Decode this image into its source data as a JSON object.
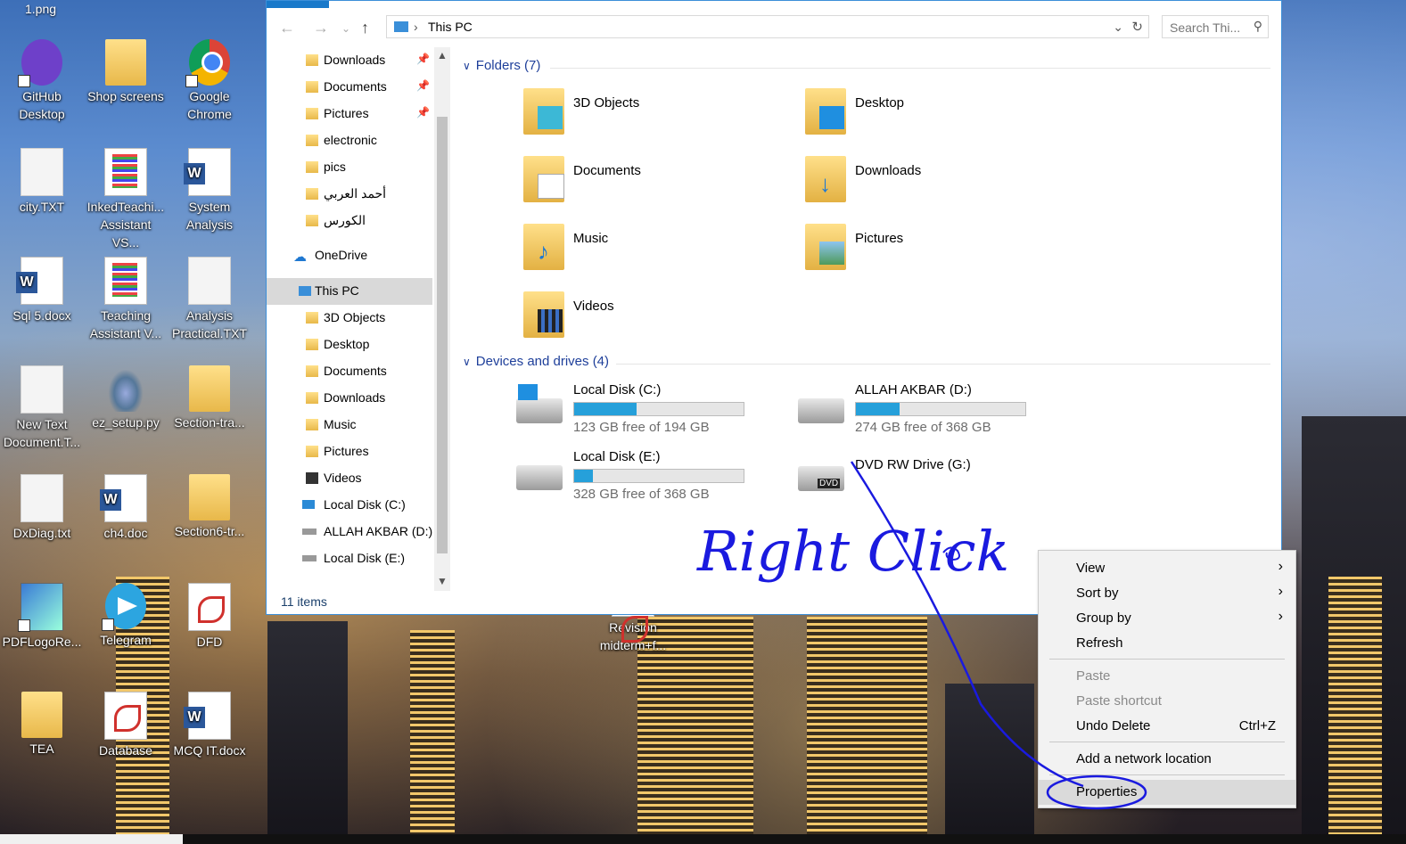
{
  "desktop": {
    "top_label": "1.png",
    "icons": [
      {
        "label": "GitHub Desktop",
        "icon": "github-icon"
      },
      {
        "label": "Shop screens",
        "icon": "folder-icon"
      },
      {
        "label": "Google Chrome",
        "icon": "chrome-icon"
      },
      {
        "label": "city.TXT",
        "icon": "text-file-icon"
      },
      {
        "label": "InkedTeachi... Assistant VS...",
        "icon": "image-file-icon"
      },
      {
        "label": "System Analysis",
        "icon": "word-doc-icon"
      },
      {
        "label": "Sql 5.docx",
        "icon": "word-doc-icon"
      },
      {
        "label": "Teaching Assistant V...",
        "icon": "image-file-icon"
      },
      {
        "label": "Analysis Practical.TXT",
        "icon": "text-file-icon"
      },
      {
        "label": "New Text Document.T...",
        "icon": "text-file-icon"
      },
      {
        "label": "ez_setup.py",
        "icon": "python-file-icon"
      },
      {
        "label": "Section-tra...",
        "icon": "folder-icon"
      },
      {
        "label": "DxDiag.txt",
        "icon": "text-file-icon"
      },
      {
        "label": "ch4.doc",
        "icon": "word-doc-icon"
      },
      {
        "label": "Section6-tr...",
        "icon": "folder-icon"
      },
      {
        "label": "PDFLogoRe...",
        "icon": "app-icon"
      },
      {
        "label": "Telegram",
        "icon": "telegram-icon"
      },
      {
        "label": "DFD",
        "icon": "pdf-icon"
      },
      {
        "label": "TEA",
        "icon": "folder-icon"
      },
      {
        "label": "Database",
        "icon": "pdf-icon"
      },
      {
        "label": "MCQ IT.docx",
        "icon": "word-doc-icon"
      },
      {
        "label": "Revision midterm+f...",
        "icon": "pdf-icon"
      }
    ]
  },
  "explorer": {
    "address": "This PC",
    "search_placeholder": "Search Thi...",
    "nav_items": [
      {
        "label": "Downloads",
        "pinned": true
      },
      {
        "label": "Documents",
        "pinned": true
      },
      {
        "label": "Pictures",
        "pinned": true
      },
      {
        "label": "electronic"
      },
      {
        "label": "pics"
      },
      {
        "label": "أحمد العربي"
      },
      {
        "label": "الكورس"
      },
      {
        "label": "OneDrive"
      },
      {
        "label": "This PC",
        "selected": true
      },
      {
        "label": "3D Objects"
      },
      {
        "label": "Desktop"
      },
      {
        "label": "Documents"
      },
      {
        "label": "Downloads"
      },
      {
        "label": "Music"
      },
      {
        "label": "Pictures"
      },
      {
        "label": "Videos"
      },
      {
        "label": "Local Disk (C:)"
      },
      {
        "label": "ALLAH AKBAR (D:)"
      },
      {
        "label": "Local Disk (E:)"
      }
    ],
    "folders_header": "Folders (7)",
    "folders": [
      "3D Objects",
      "Desktop",
      "Documents",
      "Downloads",
      "Music",
      "Pictures",
      "Videos"
    ],
    "devices_header": "Devices and drives (4)",
    "drives": [
      {
        "name": "Local Disk (C:)",
        "free": "123 GB free of 194 GB",
        "used_fraction": 0.37
      },
      {
        "name": "ALLAH AKBAR (D:)",
        "free": "274 GB free of 368 GB",
        "used_fraction": 0.26
      },
      {
        "name": "Local Disk (E:)",
        "free": "328 GB free of 368 GB",
        "used_fraction": 0.11
      },
      {
        "name": "DVD RW Drive (G:)",
        "free": "",
        "dvd_label": "DVD"
      }
    ],
    "status": "11 items",
    "accent_color": "#26a0da"
  },
  "context_menu": {
    "items": [
      {
        "label": "View",
        "submenu": true
      },
      {
        "label": "Sort by",
        "submenu": true
      },
      {
        "label": "Group by",
        "submenu": true
      },
      {
        "label": "Refresh"
      },
      {
        "label": "Paste",
        "disabled": true
      },
      {
        "label": "Paste shortcut",
        "disabled": true
      },
      {
        "label": "Undo Delete",
        "shortcut": "Ctrl+Z"
      },
      {
        "label": "Add a network location"
      },
      {
        "label": "Properties",
        "highlighted": true
      }
    ]
  },
  "annotation": {
    "text": "Right Click",
    "color": "#1a1adf"
  }
}
